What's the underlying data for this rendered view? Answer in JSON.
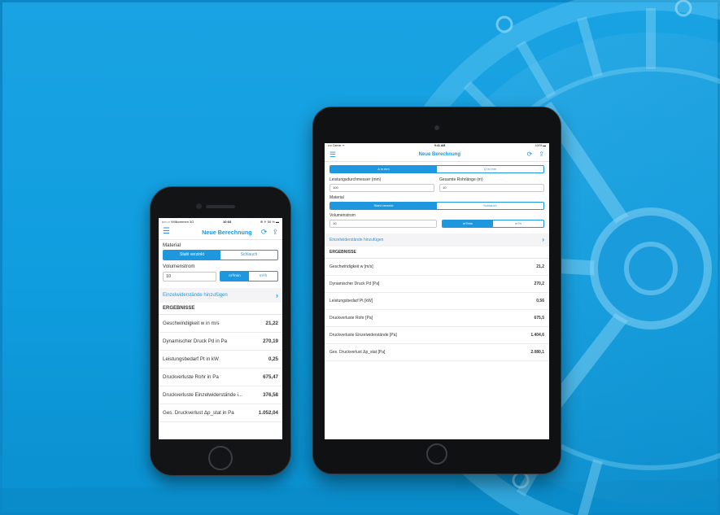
{
  "brand": {
    "accent": "#1e97df",
    "background": "#10a0e2"
  },
  "phone": {
    "status": {
      "carrier": "••○○○ Willkommen 3G",
      "time": "10:03",
      "battery": "⊕ ✳ 55 % ▬"
    },
    "nav_title": "Neue Berechnung",
    "material_label": "Material",
    "material_options": [
      "Stahl verzinkt",
      "Schlauch"
    ],
    "volumenstrom_label": "Volumenstrom",
    "volumenstrom_value": "10",
    "unit_options": [
      "m³/min",
      "m³/h"
    ],
    "add_label": "Einzelwiderstände hinzufügen",
    "results_title": "ERGEBNISSE",
    "results": [
      {
        "label": "Geschwindigkeit w in m/s",
        "value": "21,22"
      },
      {
        "label": "Dynamischer Druck Pd in Pa",
        "value": "270,19"
      },
      {
        "label": "Leistungsbedarf Pt in kW",
        "value": "0,25"
      },
      {
        "label": "Druckverluste Rohr in Pa",
        "value": "675,47"
      },
      {
        "label": "Druckverluste Einzelwiderstände i...",
        "value": "376,58"
      },
      {
        "label": "Ges. Druckverlust Δp_stat in Pa",
        "value": "1.052,04"
      }
    ]
  },
  "tablet": {
    "status": {
      "carrier": "•••• Carrier ᯤ",
      "time": "9:41 AM",
      "battery": "100% ▬"
    },
    "nav_title": "Neue Berechnung",
    "mode_options": [
      "Δ in mm",
      "Q in mm"
    ],
    "diameter_label": "Leistungsdurchmesser (mm)",
    "diameter_value": "100",
    "length_label": "Gesamte Rohrlänge (m)",
    "length_value": "10",
    "material_label": "Material",
    "material_options": [
      "Stahl verzinkt",
      "Schlauch"
    ],
    "volumenstrom_label": "Volumenstrom",
    "volumenstrom_value": "10",
    "unit_options": [
      "m³/min",
      "m³/h"
    ],
    "add_label": "Einzelwiderstände hinzufügen",
    "results_title": "ERGEBNISSE",
    "results": [
      {
        "label": "Geschwindigkeit w [m/s]",
        "value": "21,2"
      },
      {
        "label": "Dynamischer Druck Pd [Pa]",
        "value": "270,2"
      },
      {
        "label": "Leistungsbedarf Pt [kW]",
        "value": "0,56"
      },
      {
        "label": "Druckverluste Rohr [Pa]",
        "value": "675,5"
      },
      {
        "label": "Druckverluste Einzelwiderstände [Pa]",
        "value": "1.404,6"
      },
      {
        "label": "Ges. Druckverlust Δp_stat [Pa]",
        "value": "2.080,1"
      }
    ]
  }
}
